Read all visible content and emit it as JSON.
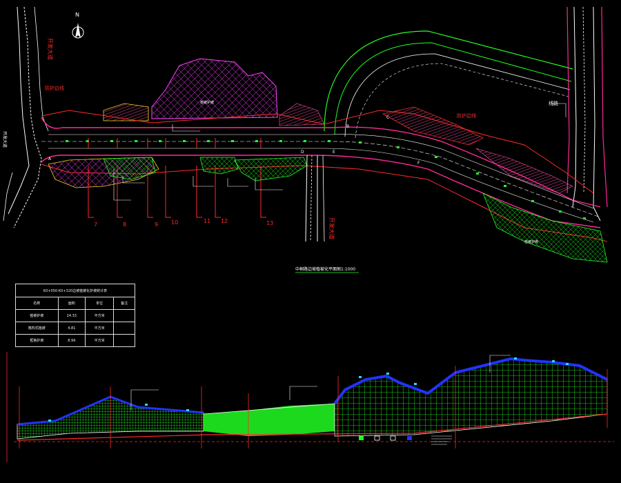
{
  "north_label": "N",
  "plan_title": "中桐路边坡植被化平面图1:1000",
  "road_labels": {
    "left_vertical": "开发大道",
    "left_vertical_2": "开发大道",
    "bottom_center": "开发大道",
    "right_top": "线路",
    "left_mark": "防护边线",
    "right_mark": "防护边线",
    "area_label_1": "植被护坡",
    "area_label_2": "植被护坡"
  },
  "section_marks": [
    "7",
    "8",
    "9",
    "10",
    "11",
    "12",
    "13"
  ],
  "point_marks": [
    "A",
    "B",
    "C",
    "D",
    "E",
    "F"
  ],
  "table": {
    "title": "K0+050-K0+320边坡植被化护坡统计表",
    "headers": [
      "名称",
      "面积",
      "单位",
      "备注"
    ],
    "rows": [
      {
        "name": "植被护坡",
        "area": "24.33",
        "unit": "平方米",
        "note": ""
      },
      {
        "name": "格构式植被",
        "area": "4.81",
        "unit": "平方米",
        "note": ""
      },
      {
        "name": "框格护坡",
        "area": "8.99",
        "unit": "平方米",
        "note": ""
      }
    ]
  },
  "colors": {
    "background": "#000000",
    "road": "#ff2a9a",
    "hatch_green": "#22ff22",
    "hatch_magenta": "#ff44ff",
    "red_line": "#ff2a2a",
    "blue_line": "#2233ff",
    "white": "#ffffff",
    "cyan": "#22e0ff",
    "yellow": "#ffd21a"
  }
}
